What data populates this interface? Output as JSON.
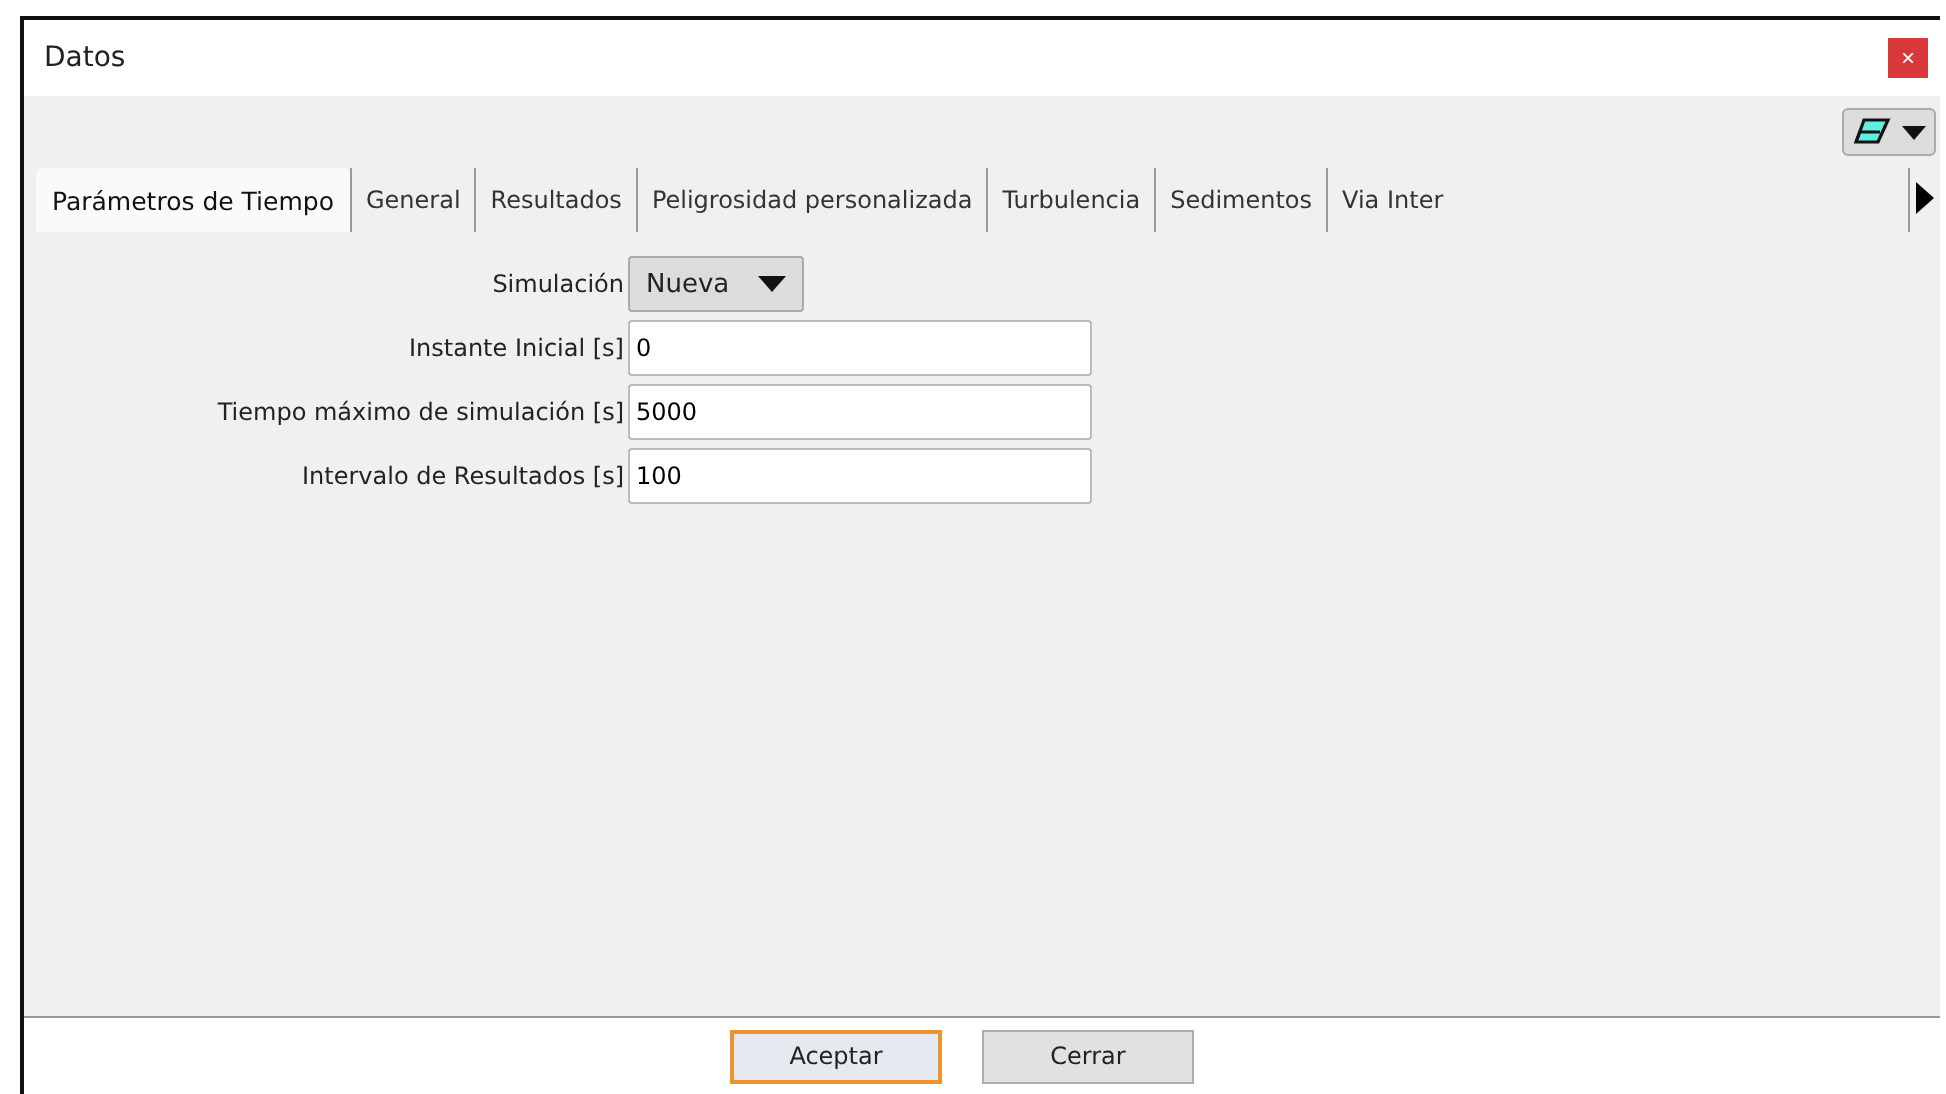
{
  "window": {
    "title": "Datos",
    "close": "×"
  },
  "tabs": [
    {
      "label": "Parámetros de Tiempo",
      "selected": true
    },
    {
      "label": "General",
      "selected": false
    },
    {
      "label": "Resultados",
      "selected": false
    },
    {
      "label": "Peligrosidad personalizada",
      "selected": false
    },
    {
      "label": "Turbulencia",
      "selected": false
    },
    {
      "label": "Sedimentos",
      "selected": false
    },
    {
      "label": "Via Inter",
      "selected": false
    }
  ],
  "form": [
    {
      "kind": "dropdown",
      "label": "Simulación",
      "value": "Nueva"
    },
    {
      "kind": "input",
      "label": "Instante Inicial [s]",
      "value": "0"
    },
    {
      "kind": "input",
      "label": "Tiempo máximo de simulación [s]",
      "value": "5000"
    },
    {
      "kind": "input",
      "label": "Intervalo de Resultados [s]",
      "value": "100"
    }
  ],
  "buttons": [
    {
      "label": "Aceptar",
      "default": true
    },
    {
      "label": "Cerrar",
      "default": false
    }
  ]
}
